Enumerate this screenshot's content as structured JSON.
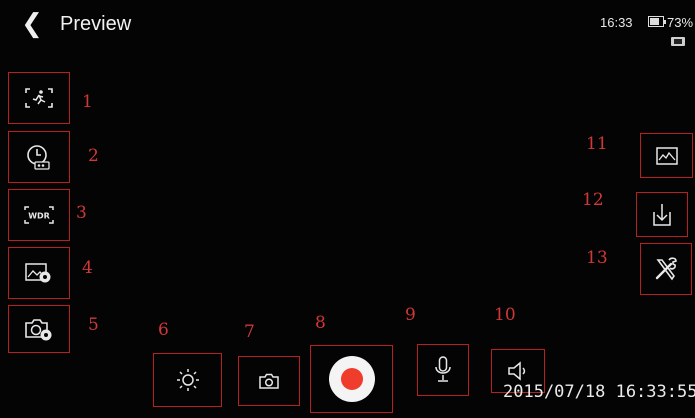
{
  "header": {
    "back_label": "❮",
    "title": "Preview",
    "time": "16:33",
    "battery_percent": "73%",
    "battery_level": 0.73
  },
  "left_buttons": [
    {
      "name": "motion-detection",
      "callout": "1",
      "icon": "motion-detect-icon"
    },
    {
      "name": "timelapse",
      "callout": "2",
      "icon": "timelapse-clock-icon"
    },
    {
      "name": "wdr",
      "callout": "3",
      "icon": "wdr-icon",
      "text": "WDR"
    },
    {
      "name": "image-settings",
      "callout": "4",
      "icon": "image-settings-icon"
    },
    {
      "name": "camera-settings",
      "callout": "5",
      "icon": "camera-settings-icon"
    }
  ],
  "bottom_buttons": [
    {
      "name": "brightness",
      "callout": "6",
      "icon": "sun-icon"
    },
    {
      "name": "snapshot",
      "callout": "7",
      "icon": "camera-icon"
    },
    {
      "name": "record",
      "callout": "8",
      "icon": "record-icon"
    },
    {
      "name": "microphone",
      "callout": "9",
      "icon": "microphone-icon"
    },
    {
      "name": "speaker",
      "callout": "10",
      "icon": "speaker-icon"
    }
  ],
  "right_buttons": [
    {
      "name": "gallery",
      "callout": "11",
      "icon": "gallery-icon"
    },
    {
      "name": "download",
      "callout": "12",
      "icon": "download-icon"
    },
    {
      "name": "tools",
      "callout": "13",
      "icon": "tools-icon"
    }
  ],
  "overlay": {
    "datestamp": "2015/07/18 16:33:55"
  },
  "colors": {
    "background": "#040404",
    "callout": "#d03838",
    "button_border": "#b62020",
    "record_red": "#ef3c2d"
  }
}
